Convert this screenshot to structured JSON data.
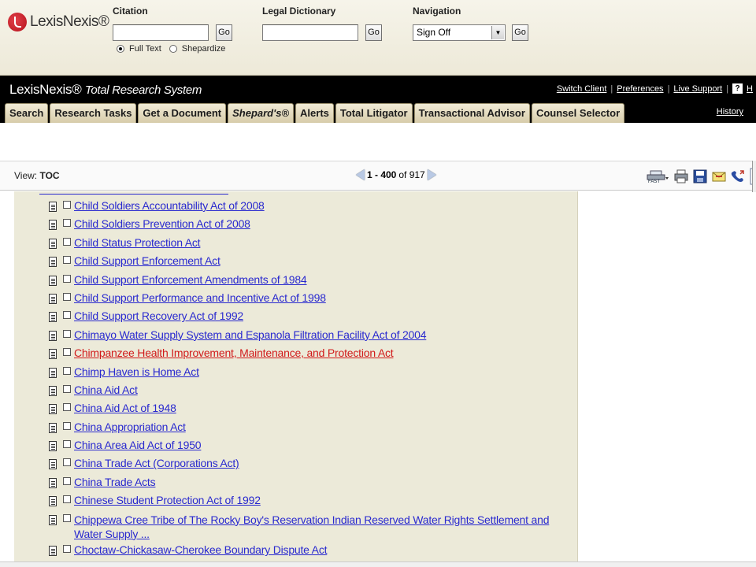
{
  "app": {
    "logo_text": "LexisNexis®",
    "brand_title": "LexisNexis®",
    "brand_subtitle": "Total Research System"
  },
  "quick_search": {
    "citation": {
      "label": "Citation",
      "value": "",
      "go": "Go"
    },
    "options": [
      {
        "label": "Full Text",
        "selected": true
      },
      {
        "label": "Shepardize",
        "selected": false
      }
    ],
    "dictionary": {
      "label": "Legal Dictionary",
      "value": "",
      "go": "Go"
    },
    "navigation": {
      "label": "Navigation",
      "selected": "Sign Off",
      "go": "Go"
    }
  },
  "header_links": [
    "Switch Client",
    "Preferences",
    "Live Support",
    "H"
  ],
  "history_link": "History",
  "tabs": [
    "Search",
    "Research Tasks",
    "Get a Document",
    "Shepard's®",
    "Alerts",
    "Total Litigator",
    "Transactional Advisor",
    "Counsel Selector"
  ],
  "toolbar": {
    "view_prefix": "View:",
    "view_value": "TOC",
    "range": "1 - 400",
    "of_text": "of 917"
  },
  "toc_items": [
    {
      "title": "Child Soldiers Accountability Act of 2008",
      "active": false
    },
    {
      "title": "Child Soldiers Prevention Act of 2008",
      "active": false
    },
    {
      "title": "Child Status Protection Act",
      "active": false
    },
    {
      "title": "Child Support Enforcement Act",
      "active": false
    },
    {
      "title": "Child Support Enforcement Amendments of 1984",
      "active": false
    },
    {
      "title": "Child Support Performance and Incentive Act of 1998",
      "active": false
    },
    {
      "title": "Child Support Recovery Act of 1992",
      "active": false
    },
    {
      "title": "Chimayo Water Supply System and Espanola Filtration Facility Act of 2004",
      "active": false
    },
    {
      "title": "Chimpanzee Health Improvement, Maintenance, and Protection Act",
      "active": true
    },
    {
      "title": "Chimp Haven is Home Act",
      "active": false
    },
    {
      "title": "China Aid Act",
      "active": false
    },
    {
      "title": "China Aid Act of 1948",
      "active": false
    },
    {
      "title": "China Appropriation Act",
      "active": false
    },
    {
      "title": "China Area Aid Act of 1950",
      "active": false
    },
    {
      "title": "China Trade Act (Corporations Act)",
      "active": false
    },
    {
      "title": "China Trade Acts",
      "active": false
    },
    {
      "title": "Chinese Student Protection Act of 1992",
      "active": false
    },
    {
      "title": "Chippewa Cree Tribe of The Rocky Boy's Reservation Indian Reserved Water Rights Settlement and Water Supply ...",
      "active": false,
      "wrap": true
    },
    {
      "title": "Choctaw-Chickasaw-Cherokee Boundary Dispute Act",
      "active": false
    }
  ],
  "icons": [
    "fast-print-icon",
    "printer-icon",
    "save-icon",
    "email-icon",
    "phone-icon"
  ]
}
